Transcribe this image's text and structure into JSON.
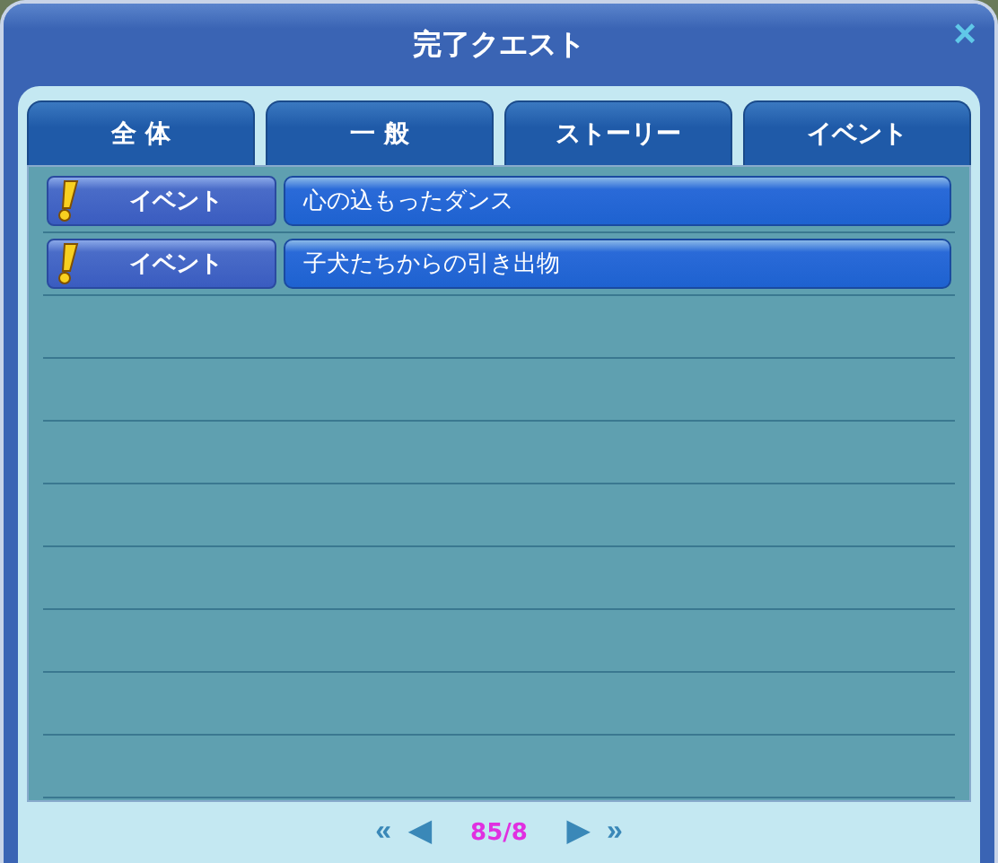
{
  "window": {
    "title": "完了クエスト",
    "close": "×"
  },
  "tabs": [
    {
      "label": "全 体",
      "selected": false
    },
    {
      "label": "一 般",
      "selected": false
    },
    {
      "label": "ストーリー",
      "selected": false
    },
    {
      "label": "イベント",
      "selected": false
    }
  ],
  "quests": [
    {
      "category": "イベント",
      "name": "心の込もったダンス"
    },
    {
      "category": "イベント",
      "name": "子犬たちからの引き出物"
    }
  ],
  "pager": {
    "first": "«",
    "prev": "◀",
    "page": "85/8",
    "next": "▶",
    "last": "»"
  }
}
